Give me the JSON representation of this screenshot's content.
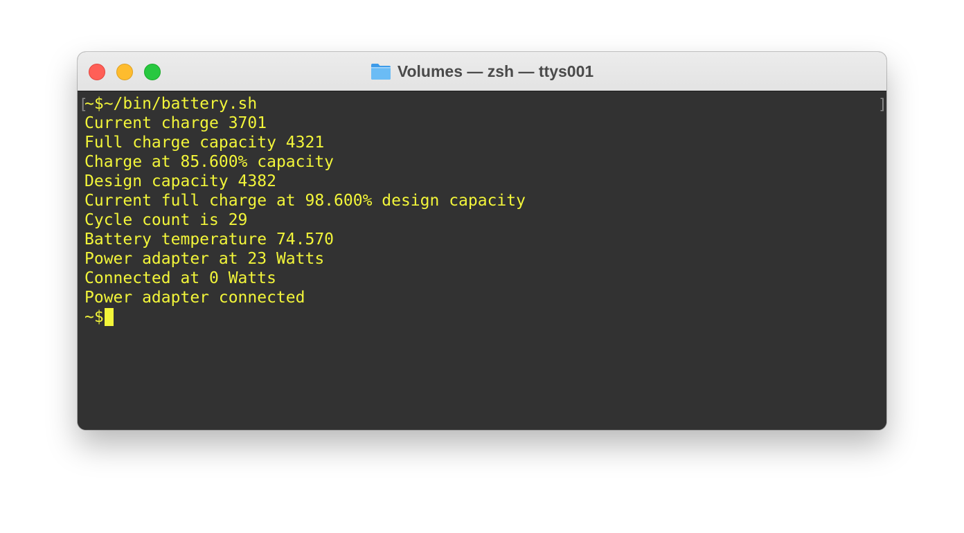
{
  "window": {
    "title": "Volumes — zsh — ttys001",
    "title_icon": "folder-icon",
    "controls": {
      "close": "close-icon",
      "minimize": "minimize-icon",
      "zoom": "zoom-icon"
    }
  },
  "terminal": {
    "colors": {
      "background": "#323232",
      "text": "#f2f53a"
    },
    "bracket_left": "[",
    "bracket_right": "]",
    "lines": [
      "~$~/bin/battery.sh",
      "Current charge 3701",
      "Full charge capacity 4321",
      "Charge at 85.600% capacity",
      "Design capacity 4382",
      "Current full charge at 98.600% design capacity",
      "Cycle count is 29",
      "Battery temperature 74.570",
      "Power adapter at 23 Watts",
      "Connected at 0 Watts",
      "Power adapter connected"
    ],
    "prompt": "~$"
  }
}
